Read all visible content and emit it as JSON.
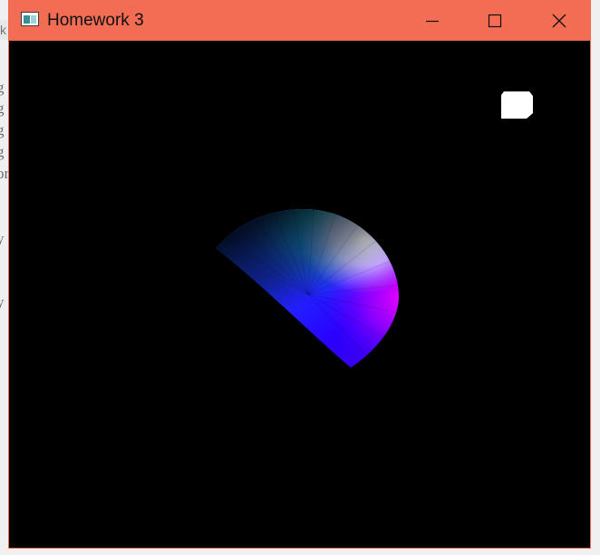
{
  "window": {
    "title": "Homework 3",
    "titlebar_color": "#f36d55",
    "controls": [
      "minimize-icon",
      "maximize-icon",
      "close-icon"
    ]
  },
  "background_window": {
    "tab_fragment": "k",
    "text_fragments": [
      "g",
      "g",
      "g",
      "g",
      "or",
      "y",
      "y"
    ]
  },
  "scene": {
    "background_color": "#000000",
    "light_marker_color": "#ffffff"
  }
}
